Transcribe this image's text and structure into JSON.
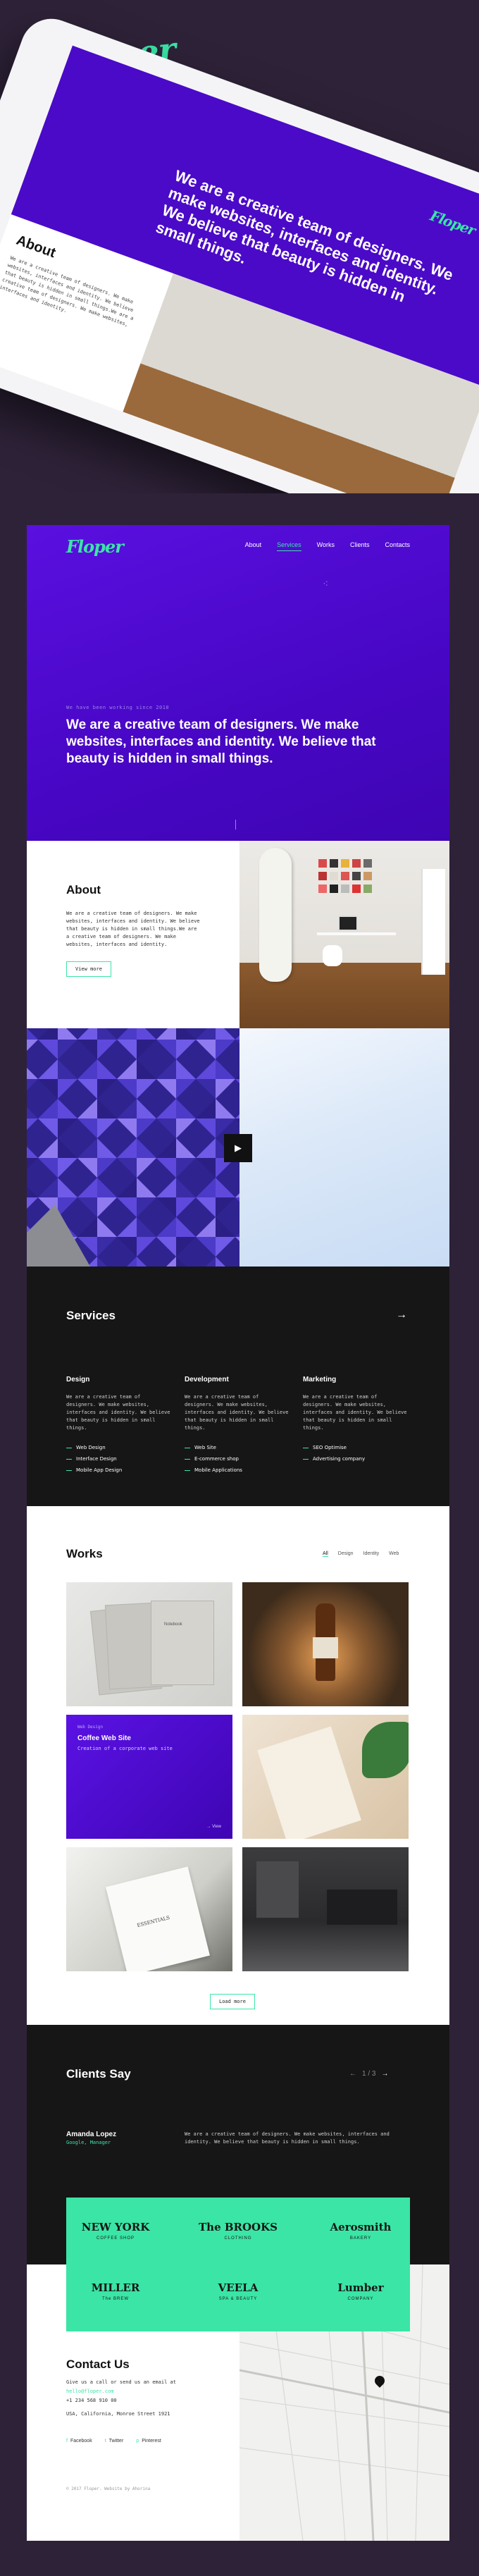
{
  "brand": {
    "logo_text": "Floper",
    "accent": "#3be5a6",
    "primary": "#4706c4"
  },
  "nav": {
    "items": [
      "About",
      "Services",
      "Works",
      "Clients",
      "Contacts"
    ],
    "active": "Services"
  },
  "hero": {
    "kicker": "We have been working since 2010",
    "title": "We are a creative team of designers. We make websites, interfaces and identity. We believe that beauty is hidden in small things."
  },
  "about": {
    "heading": "About",
    "text": "We are a creative team of designers. We make websites, interfaces and identity. We believe that beauty is hidden in small things.We are a creative team of designers. We make websites, interfaces and identity.",
    "button": "View more"
  },
  "tablet": {
    "about_heading": "About",
    "hero_text": "We are a creative team of designers. We make websites, interfaces and identity. We believe that beauty is hidden in small things."
  },
  "services": {
    "heading": "Services",
    "columns": [
      {
        "title": "Design",
        "text": "We are a creative team of designers. We make websites, interfaces and identity. We believe that beauty is hidden in small things.",
        "items": [
          "Web Design",
          "Interface Design",
          "Mobile App Design"
        ]
      },
      {
        "title": "Development",
        "text": "We are a creative team of designers. We make websites, interfaces and identity. We believe that beauty is hidden in small things.",
        "items": [
          "Web Site",
          "E-commerce shop",
          "Mobile Applications"
        ]
      },
      {
        "title": "Marketing",
        "text": "We are a creative team of designers. We make websites, interfaces and identity. We believe that beauty is hidden in small things.",
        "items": [
          "SEO Optimise",
          "Advertising company"
        ]
      }
    ]
  },
  "works": {
    "heading": "Works",
    "filters": [
      "All",
      "Design",
      "Identity",
      "Web"
    ],
    "active_filter": "All",
    "featured": {
      "tag": "Web Design",
      "title": "Coffee Web Site",
      "subtitle": "Creation of a corporate web site",
      "more": "→ View"
    },
    "book_label": "Notebook",
    "card_label": "ESSENTIALS",
    "load_more": "Load more"
  },
  "clients": {
    "heading": "Clients Say",
    "pager": "1 / 3",
    "name": "Amanda Lopez",
    "role": "Google, Manager",
    "quote": "We are a creative team of designers. We make websites, interfaces and identity. We believe that beauty is hidden in small things.",
    "logos": [
      {
        "name": "NEW YORK",
        "sub": "COFFEE SHOP"
      },
      {
        "name": "The BROOKS",
        "sub": "CLOTHING"
      },
      {
        "name": "Aerosmith",
        "sub": "BAKERY"
      },
      {
        "name": "MILLER",
        "sub": "The BREW"
      },
      {
        "name": "VEELA",
        "sub": "SPA & BEAUTY"
      },
      {
        "name": "Lumber",
        "sub": "COMPANY"
      }
    ]
  },
  "contact": {
    "heading": "Contact Us",
    "intro": "Give us a call or send us an email at",
    "email": "hello@floper.com",
    "phone": "+1 234 568 910 00",
    "address": "USA, California, Monroe Street 1921",
    "socials": [
      "Facebook",
      "Twitter",
      "Pinterest"
    ],
    "copyright": "© 2017 Floper. Website by Ahorina"
  }
}
